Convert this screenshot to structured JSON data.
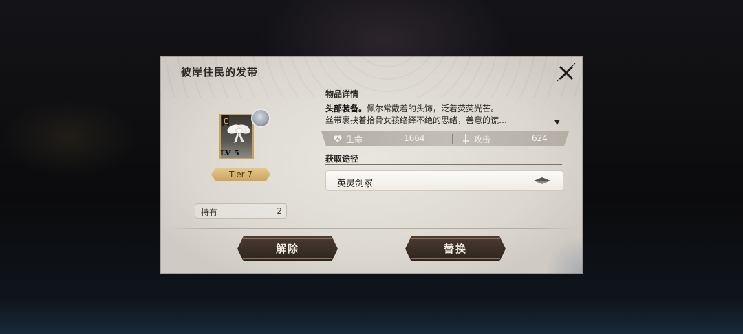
{
  "dialog": {
    "title": "彼岸住民的发带",
    "close_icon": "close-icon"
  },
  "item": {
    "level": "LV 5",
    "tier": "Tier 7",
    "hold_label": "持有",
    "hold_value": "2",
    "slot_icon": "headgear-slot-icon",
    "art_icon": "ribbon-item-icon",
    "character_icon": "character-portrait-icon"
  },
  "details": {
    "header": "物品详情",
    "desc_bold": "头部装备。",
    "desc_line1": "佩尔常戴着的头饰，泛着荧荧光芒。",
    "desc_line2": "丝带裹挟着拾骨女孩络绎不绝的思绪，善意的谎…",
    "expand_icon": "expand-down-icon",
    "stats": {
      "hp_label": "生命",
      "hp_value": "1664",
      "atk_label": "攻击",
      "atk_value": "624"
    }
  },
  "source": {
    "header": "获取途径",
    "item_label": "英灵剑冢",
    "arrow_icon": "go-arrow-icon"
  },
  "buttons": {
    "unequip": "解除",
    "replace": "替换"
  },
  "colors": {
    "panel": "#e3dfd8",
    "button": "#3a2e27",
    "gold": "#c9a35d"
  }
}
